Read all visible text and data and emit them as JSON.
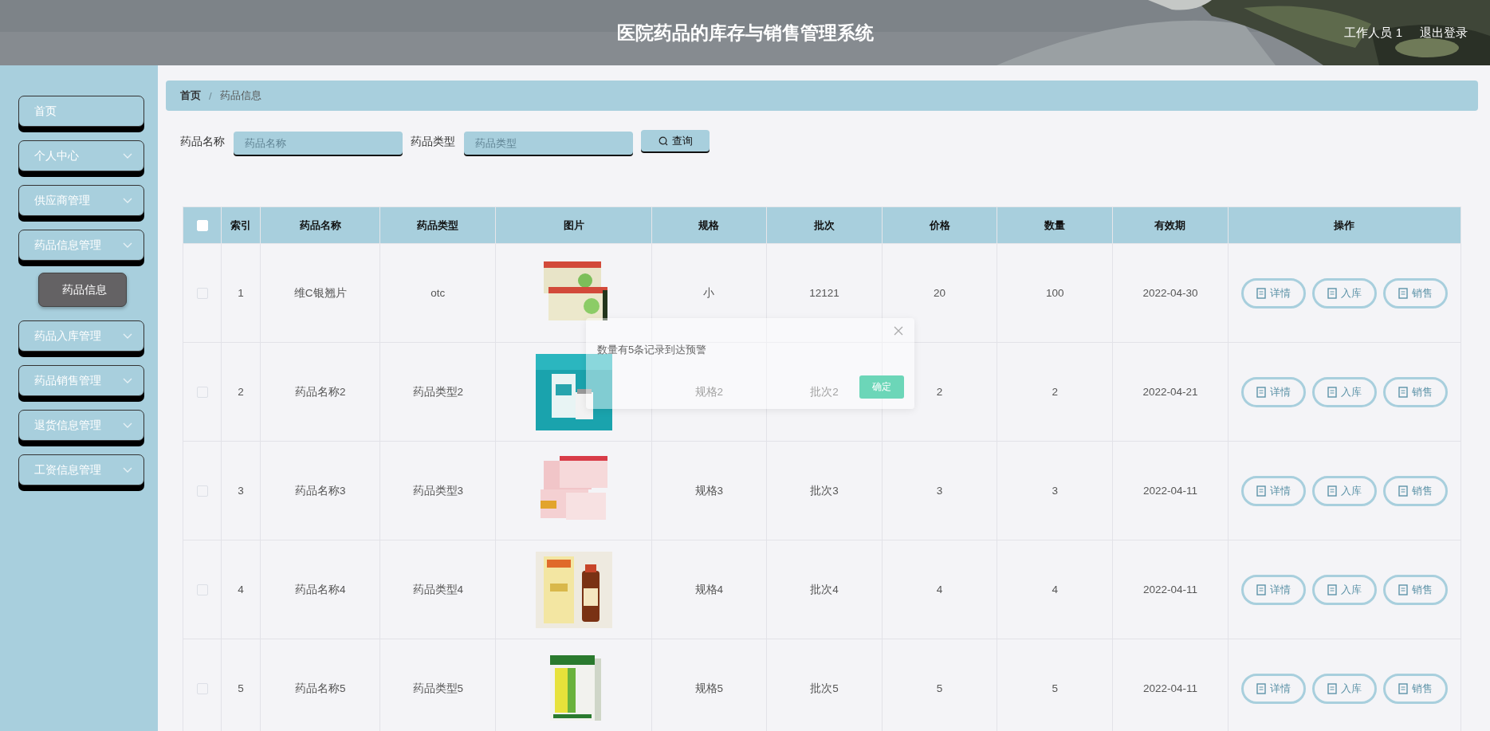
{
  "header": {
    "title": "医院药品的库存与销售管理系统",
    "user": "工作人员 1",
    "logout": "退出登录"
  },
  "sidebar": {
    "items": [
      {
        "label": "首页",
        "kind": "link"
      },
      {
        "label": "个人中心",
        "kind": "menu"
      },
      {
        "label": "供应商管理",
        "kind": "menu"
      },
      {
        "label": "药品信息管理",
        "kind": "menu",
        "children": [
          {
            "label": "药品信息",
            "selected": true
          }
        ]
      },
      {
        "label": "药品入库管理",
        "kind": "menu"
      },
      {
        "label": "药品销售管理",
        "kind": "menu"
      },
      {
        "label": "退货信息管理",
        "kind": "menu"
      },
      {
        "label": "工资信息管理",
        "kind": "menu"
      }
    ]
  },
  "breadcrumb": {
    "items": [
      "首页",
      "药品信息"
    ],
    "separator": "/"
  },
  "search": {
    "fields": [
      {
        "label": "药品名称",
        "placeholder": "药品名称"
      },
      {
        "label": "药品类型",
        "placeholder": "药品类型"
      }
    ],
    "button": "查询"
  },
  "table": {
    "all_checked": false,
    "columns": [
      "索引",
      "药品名称",
      "药品类型",
      "图片",
      "规格",
      "批次",
      "价格",
      "数量",
      "有效期",
      "操作"
    ],
    "rows": [
      {
        "checked": false,
        "cells": [
          "1",
          "维C银翘片",
          "otc",
          {
            "kind": "picture"
          },
          "小",
          "12121",
          "20",
          "100",
          "2022-04-30"
        ],
        "actions": [
          "详情",
          "入库",
          "销售"
        ]
      },
      {
        "checked": false,
        "cells": [
          "2",
          "药品名称2",
          "药品类型2",
          {
            "kind": "picture"
          },
          "规格2",
          "批次2",
          "2",
          "2",
          "2022-04-21"
        ],
        "actions": [
          "详情",
          "入库",
          "销售"
        ]
      },
      {
        "checked": false,
        "cells": [
          "3",
          "药品名称3",
          "药品类型3",
          {
            "kind": "picture"
          },
          "规格3",
          "批次3",
          "3",
          "3",
          "2022-04-11"
        ],
        "actions": [
          "详情",
          "入库",
          "销售"
        ]
      },
      {
        "checked": false,
        "cells": [
          "4",
          "药品名称4",
          "药品类型4",
          {
            "kind": "picture"
          },
          "规格4",
          "批次4",
          "4",
          "4",
          "2022-04-11"
        ],
        "actions": [
          "详情",
          "入库",
          "销售"
        ]
      },
      {
        "checked": false,
        "cells": [
          "5",
          "药品名称5",
          "药品类型5",
          {
            "kind": "picture"
          },
          "规格5",
          "批次5",
          "5",
          "5",
          "2022-04-11"
        ],
        "actions": [
          "详情",
          "入库",
          "销售"
        ]
      }
    ]
  },
  "dialog": {
    "message": "数量有5条记录到达预警",
    "button": "确定"
  }
}
